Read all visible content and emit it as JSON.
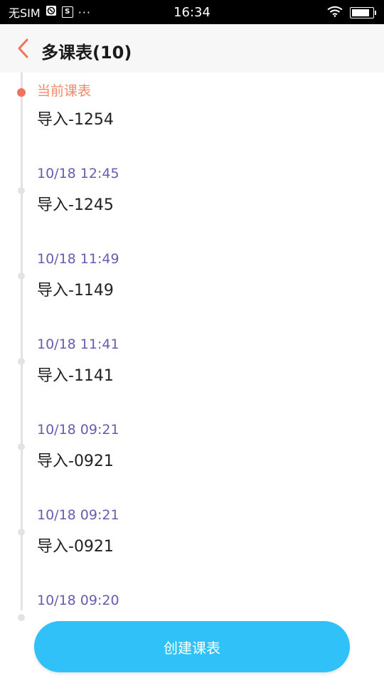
{
  "status_bar": {
    "carrier": "无SIM",
    "box_icon_letter": "S",
    "more": "···",
    "time": "16:34",
    "battery_level": 0.95
  },
  "header": {
    "title": "多课表(10)"
  },
  "timeline": [
    {
      "time": "当前课表",
      "name": "导入-1254",
      "current": true
    },
    {
      "time": "10/18 12:45",
      "name": "导入-1245",
      "current": false
    },
    {
      "time": "10/18 11:49",
      "name": "导入-1149",
      "current": false
    },
    {
      "time": "10/18 11:41",
      "name": "导入-1141",
      "current": false
    },
    {
      "time": "10/18 09:21",
      "name": "导入-0921",
      "current": false
    },
    {
      "time": "10/18 09:21",
      "name": "导入-0921",
      "current": false
    },
    {
      "time": "10/18 09:20",
      "name": "",
      "current": false
    }
  ],
  "actions": {
    "create_label": "创建课表"
  },
  "colors": {
    "accent": "#f0735b",
    "time_text": "#6b5bb0",
    "button": "#2fc1f7"
  }
}
